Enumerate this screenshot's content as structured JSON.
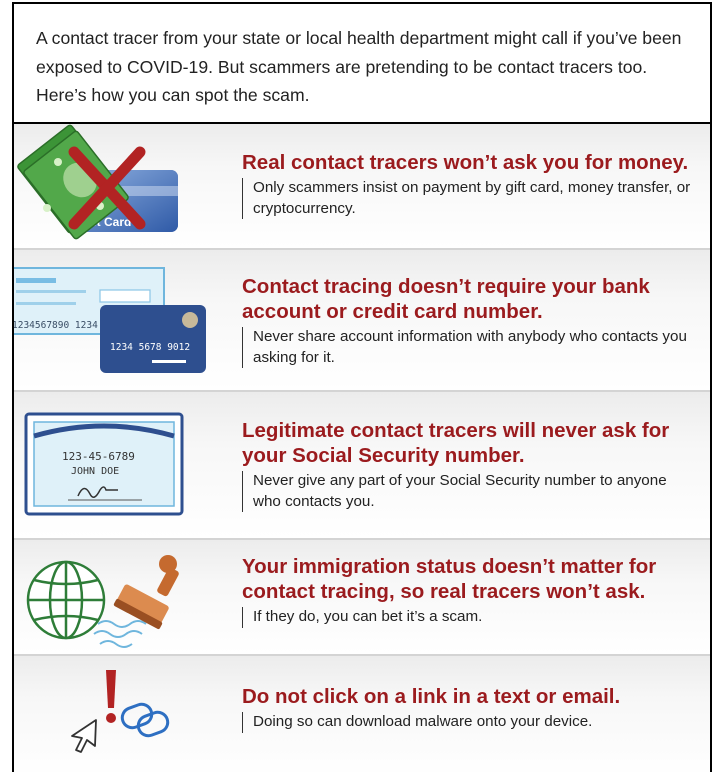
{
  "intro": {
    "text": "A contact tracer from your state or local health department might call if you’ve been exposed to COVID-19. But scammers are pretending to be contact tracers too. Here’s how you can spot the scam."
  },
  "tips": [
    {
      "title": "Real contact tracers won’t ask you for money.",
      "description": "Only scammers insist on payment by gift card, money transfer, or cryptocurrency.",
      "icon": "money-gift-card-crossed-icon",
      "icon_text": "Gift Card"
    },
    {
      "title": "Contact tracing doesn’t require your bank account or credit card number.",
      "description": "Never share account information with anybody who contacts you asking for it.",
      "icon": "check-and-credit-card-icon",
      "icon_text_check": "1234567890 1234",
      "icon_text_card": "1234 5678 9012"
    },
    {
      "title": "Legitimate contact tracers will never ask for your Social Security number.",
      "description": "Never give any part of your Social Security number to anyone who contacts you.",
      "icon": "social-security-card-icon",
      "icon_text_number": "123-45-6789",
      "icon_text_name": "JOHN DOE"
    },
    {
      "title": "Your immigration status doesn’t matter for contact tracing, so real tracers won’t ask.",
      "description": "If they do, you can bet it’s a scam.",
      "icon": "globe-and-stamp-icon"
    },
    {
      "title": "Do not click on a link in a text or email.",
      "description": "Doing so can download malware onto your device.",
      "icon": "cursor-alert-link-icon"
    }
  ],
  "colors": {
    "heading": "#9b1b1e",
    "body_text": "#222222",
    "money_green": "#3f9a3a",
    "cross_red": "#b22323",
    "card_blue": "#2e4f8f",
    "check_light_blue": "#dff1f9"
  }
}
